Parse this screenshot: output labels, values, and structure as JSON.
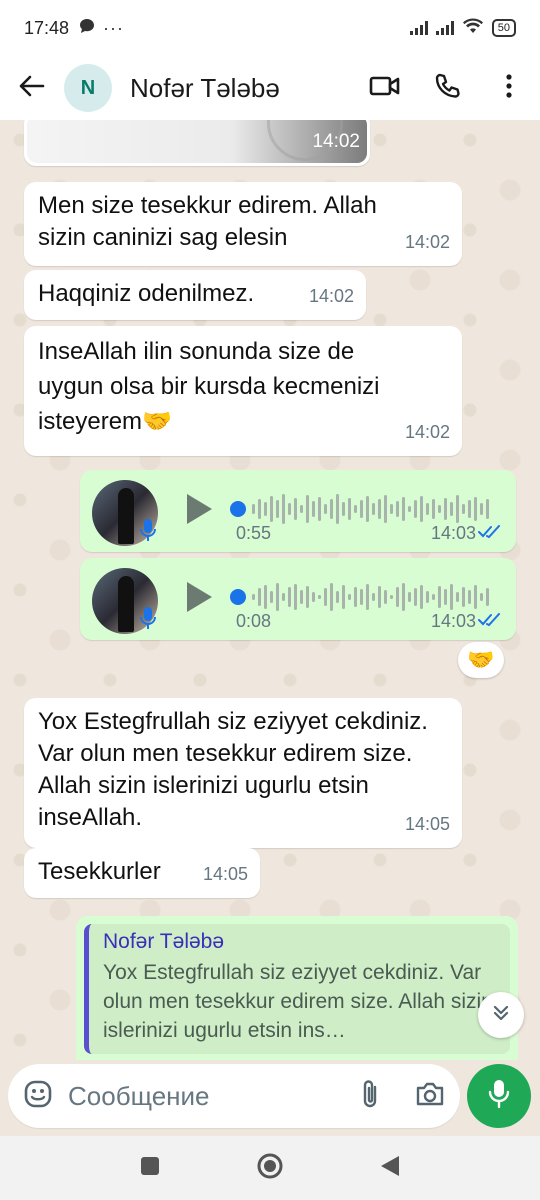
{
  "status_bar": {
    "time": "17:48",
    "battery": "50"
  },
  "header": {
    "avatar_letter": "N",
    "contact_name": "Nofər Tələbə"
  },
  "messages": [
    {
      "type": "image",
      "time": "14:02"
    },
    {
      "type": "text",
      "text": "Men size tesekkur edirem. Allah sizin caninizi sag elesin",
      "time": "14:02"
    },
    {
      "type": "text",
      "text": "Haqqiniz odenilmez.",
      "time": "14:02"
    },
    {
      "type": "text",
      "text": "InseAllah ilin sonunda size de uygun olsa bir kursda kecmenizi isteyerem🤝",
      "time": "14:02"
    },
    {
      "type": "voice",
      "duration": "0:55",
      "time": "14:03"
    },
    {
      "type": "voice",
      "duration": "0:08",
      "time": "14:03"
    },
    {
      "type": "text",
      "text": "Yox Estegfrullah siz eziyyet cekdiniz. Var olun men tesekkur edirem size. Allah sizin islerinizi ugurlu etsin inseAllah.",
      "time": "14:05"
    },
    {
      "type": "text",
      "text": "Tesekkurler",
      "time": "14:05"
    }
  ],
  "reaction": "🤝",
  "reply": {
    "quoted_name": "Nofər Tələbə",
    "quoted_text": "Yox Estegfrullah siz eziyyet cekdiniz. Var olun men tesekkur edirem size. Allah sizin islerinizi ugurlu etsin ins…"
  },
  "composer": {
    "placeholder": "Сообщение"
  },
  "colors": {
    "accent": "#1fa855",
    "outgoing_bubble": "#d9fdd3",
    "read_ticks": "#1a73e8",
    "quote_bar": "#5b4fd1"
  },
  "icons": [
    "back-arrow-icon",
    "video-call-icon",
    "phone-icon",
    "more-icon",
    "play-icon",
    "mic-icon",
    "double-check-icon",
    "chevron-down-icon",
    "emoji-icon",
    "attach-icon",
    "camera-icon",
    "nav-square-icon",
    "nav-home-icon",
    "nav-back-icon"
  ]
}
